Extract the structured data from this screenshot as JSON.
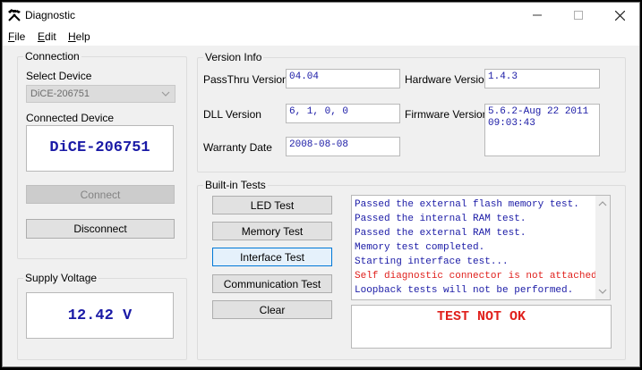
{
  "window": {
    "title": "Diagnostic",
    "controls": {
      "minimize": "minimize",
      "maximize": "maximize",
      "close": "close"
    }
  },
  "menu": [
    {
      "label": "File",
      "accel": "F",
      "rest": "ile"
    },
    {
      "label": "Edit",
      "accel": "E",
      "rest": "dit"
    },
    {
      "label": "Help",
      "accel": "H",
      "rest": "elp"
    }
  ],
  "connection": {
    "group_title": "Connection",
    "select_device_label": "Select Device",
    "selected_device": "DiCE-206751",
    "connected_device_label": "Connected Device",
    "connected_device": "DiCE-206751",
    "connect_label": "Connect",
    "disconnect_label": "Disconnect"
  },
  "supply": {
    "group_title": "Supply Voltage",
    "value": "12.42 V"
  },
  "version": {
    "group_title": "Version Info",
    "passthru_label": "PassThru Version",
    "passthru_value": "04.04",
    "hardware_label": "Hardware Version",
    "hardware_value": "1.4.3",
    "dll_label": "DLL Version",
    "dll_value": "6, 1, 0, 0",
    "firmware_label": "Firmware Version",
    "firmware_value": "5.6.2-Aug 22 2011\n09:03:43",
    "warranty_label": "Warranty Date",
    "warranty_value": "2008-08-08"
  },
  "tests": {
    "group_title": "Built-in Tests",
    "buttons": [
      "LED Test",
      "Memory Test",
      "Interface Test",
      "Communication Test",
      "Clear"
    ],
    "log": [
      {
        "text": "Passed the external flash memory test.",
        "color": "#1a1aa6"
      },
      {
        "text": "Passed the internal RAM test.",
        "color": "#1a1aa6"
      },
      {
        "text": "Passed the external RAM test.",
        "color": "#1a1aa6"
      },
      {
        "text": "Memory test completed.",
        "color": "#1a1aa6"
      },
      {
        "text": "Starting interface test...",
        "color": "#1a1aa6"
      },
      {
        "text": "Self diagnostic connector is not attached.",
        "color": "#e0201c"
      },
      {
        "text": "Loopback tests will not be performed.",
        "color": "#1a1aa6"
      }
    ],
    "result": "TEST NOT OK"
  },
  "colors": {
    "value_text": "#1a1aa6",
    "error_text": "#e0201c",
    "focus_border": "#0078d7"
  }
}
